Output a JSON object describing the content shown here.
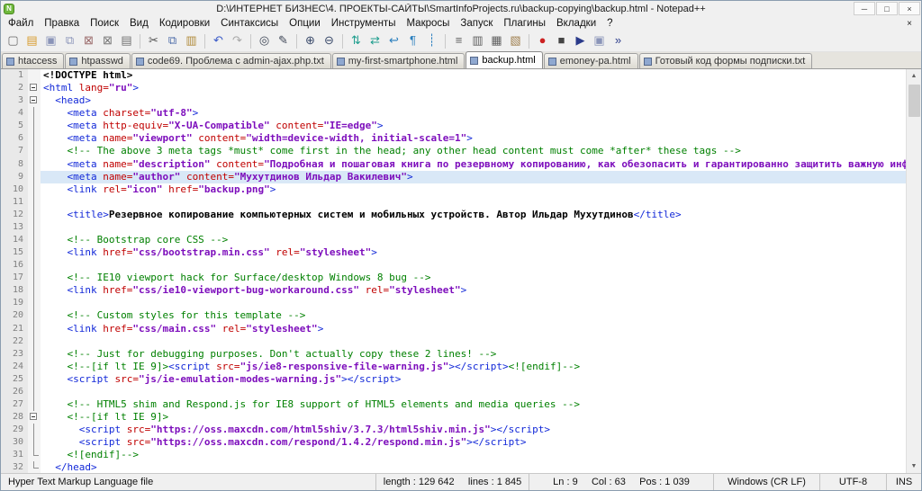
{
  "titlebar": {
    "title": "D:\\ИНТЕРНЕТ БИЗНЕС\\4. ПРОЕКТЫ-САЙТЫ\\SmartInfoProjects.ru\\backup-copying\\backup.html - Notepad++",
    "logo_letter": "N",
    "buttons": [
      {
        "name": "minimize",
        "glyph": "─"
      },
      {
        "name": "maximize",
        "glyph": "□"
      },
      {
        "name": "close",
        "glyph": "×"
      }
    ]
  },
  "menubar": {
    "items": [
      "Файл",
      "Правка",
      "Поиск",
      "Вид",
      "Кодировки",
      "Синтаксисы",
      "Опции",
      "Инструменты",
      "Макросы",
      "Запуск",
      "Плагины",
      "Вкладки",
      "?"
    ],
    "close_glyph": "×"
  },
  "toolbar": {
    "icons": [
      {
        "name": "new-file",
        "glyph": "▢",
        "color": "#6a6a6a"
      },
      {
        "name": "open-folder",
        "glyph": "▤",
        "color": "#d89c2e"
      },
      {
        "name": "save-file",
        "glyph": "▣",
        "color": "#8a94b8"
      },
      {
        "name": "save-all",
        "glyph": "⧉",
        "color": "#8a94b8"
      },
      {
        "name": "close-file",
        "glyph": "⊠",
        "color": "#9a6a6a"
      },
      {
        "name": "close-all",
        "glyph": "⊠",
        "color": "#777777"
      },
      {
        "name": "print",
        "glyph": "▤",
        "color": "#707070"
      },
      {
        "sep": true
      },
      {
        "name": "cut",
        "glyph": "✂",
        "color": "#505050"
      },
      {
        "name": "copy",
        "glyph": "⧉",
        "color": "#4a6aa8"
      },
      {
        "name": "paste",
        "glyph": "▥",
        "color": "#b08a3a"
      },
      {
        "sep": true
      },
      {
        "name": "undo",
        "glyph": "↶",
        "color": "#3a5ac8"
      },
      {
        "name": "redo",
        "glyph": "↷",
        "color": "#a8a8a8"
      },
      {
        "sep": true
      },
      {
        "name": "find",
        "glyph": "◎",
        "color": "#404858"
      },
      {
        "name": "replace",
        "glyph": "✎",
        "color": "#404858"
      },
      {
        "sep": true
      },
      {
        "name": "zoom-in",
        "glyph": "⊕",
        "color": "#3a4a6a"
      },
      {
        "name": "zoom-out",
        "glyph": "⊖",
        "color": "#3a4a6a"
      },
      {
        "sep": true
      },
      {
        "name": "sync-vertical-scroll",
        "glyph": "⇅",
        "color": "#1f9e8e"
      },
      {
        "name": "sync-horizontal-scroll",
        "glyph": "⇄",
        "color": "#1f9e8e"
      },
      {
        "name": "word-wrap",
        "glyph": "↩",
        "color": "#2a7fbe"
      },
      {
        "name": "show-all-characters",
        "glyph": "¶",
        "color": "#2a7fbe"
      },
      {
        "name": "indent-guide",
        "glyph": "┊",
        "color": "#2a7fbe"
      },
      {
        "sep": true
      },
      {
        "name": "function-list",
        "glyph": "≡",
        "color": "#606060"
      },
      {
        "name": "document-map",
        "glyph": "▥",
        "color": "#606060"
      },
      {
        "name": "document-list",
        "glyph": "▦",
        "color": "#606060"
      },
      {
        "name": "folder-as-workspace",
        "glyph": "▧",
        "color": "#a08050"
      },
      {
        "sep": true
      },
      {
        "name": "macro-record",
        "glyph": "●",
        "color": "#cc2222"
      },
      {
        "name": "macro-stop",
        "glyph": "■",
        "color": "#444444"
      },
      {
        "name": "macro-play",
        "glyph": "▶",
        "color": "#2a3a8a"
      },
      {
        "name": "macro-save",
        "glyph": "▣",
        "color": "#8a94b8"
      },
      {
        "name": "macro-run-multiple",
        "glyph": "»",
        "color": "#2a3a8a"
      }
    ]
  },
  "tabbar": {
    "tabs": [
      {
        "label": "htaccess",
        "active": false
      },
      {
        "label": "htpasswd",
        "active": false
      },
      {
        "label": "code69. Проблема с admin-ajax.php.txt",
        "active": false
      },
      {
        "label": "my-first-smartphone.html",
        "active": false
      },
      {
        "label": "backup.html",
        "active": true
      },
      {
        "label": "emoney-pa.html",
        "active": false
      },
      {
        "label": "Готовый код формы подписки.txt",
        "active": false
      }
    ]
  },
  "editor": {
    "current_line": 9,
    "lines": [
      {
        "n": 1,
        "fold": "",
        "tokens": [
          [
            "d",
            "<!DOCTYPE html>"
          ]
        ]
      },
      {
        "n": 2,
        "fold": "o",
        "tokens": [
          [
            "t",
            "<html "
          ],
          [
            "a",
            "lang="
          ],
          [
            "v",
            "\"ru\""
          ],
          [
            "t",
            ">"
          ]
        ]
      },
      {
        "n": 3,
        "fold": "o",
        "tokens": [
          [
            "t",
            "  <head>"
          ]
        ]
      },
      {
        "n": 4,
        "fold": "p",
        "tokens": [
          [
            "t",
            "    <meta "
          ],
          [
            "a",
            "charset="
          ],
          [
            "v",
            "\"utf-8\""
          ],
          [
            "t",
            ">"
          ]
        ]
      },
      {
        "n": 5,
        "fold": "p",
        "tokens": [
          [
            "t",
            "    <meta "
          ],
          [
            "a",
            "http-equiv="
          ],
          [
            "v",
            "\"X-UA-Compatible\""
          ],
          [
            "a",
            " content="
          ],
          [
            "v",
            "\"IE=edge\""
          ],
          [
            "t",
            ">"
          ]
        ]
      },
      {
        "n": 6,
        "fold": "p",
        "tokens": [
          [
            "t",
            "    <meta "
          ],
          [
            "a",
            "name="
          ],
          [
            "v",
            "\"viewport\""
          ],
          [
            "a",
            " content="
          ],
          [
            "v",
            "\"width=device-width, initial-scale=1\""
          ],
          [
            "t",
            ">"
          ]
        ]
      },
      {
        "n": 7,
        "fold": "p",
        "tokens": [
          [
            "c",
            "    <!-- The above 3 meta tags *must* come first in the head; any other head content must come *after* these tags -->"
          ]
        ]
      },
      {
        "n": 8,
        "fold": "p",
        "tokens": [
          [
            "t",
            "    <meta "
          ],
          [
            "a",
            "name="
          ],
          [
            "v",
            "\"description\""
          ],
          [
            "a",
            " content="
          ],
          [
            "v",
            "\"Подробная и пошаговая книга по резервному копированию, как обезопасить и гарантированно защитить важную информацию от внез"
          ]
        ]
      },
      {
        "n": 9,
        "fold": "p",
        "tokens": [
          [
            "t",
            "    <meta "
          ],
          [
            "a",
            "name="
          ],
          [
            "v",
            "\"author\""
          ],
          [
            "a",
            " content="
          ],
          [
            "v",
            "\"Мухутдинов Ильдар Вакилевич\""
          ],
          [
            "t",
            ">"
          ]
        ]
      },
      {
        "n": 10,
        "fold": "p",
        "tokens": [
          [
            "t",
            "    <link "
          ],
          [
            "a",
            "rel="
          ],
          [
            "v",
            "\"icon\""
          ],
          [
            "a",
            " href="
          ],
          [
            "v",
            "\"backup.png\""
          ],
          [
            "t",
            ">"
          ]
        ]
      },
      {
        "n": 11,
        "fold": "p",
        "tokens": []
      },
      {
        "n": 12,
        "fold": "p",
        "tokens": [
          [
            "t",
            "    <title>"
          ],
          [
            "b",
            "Резервное копирование компьютерных систем и мобильных устройств. Автор Ильдар Мухутдинов"
          ],
          [
            "t",
            "</title>"
          ]
        ]
      },
      {
        "n": 13,
        "fold": "p",
        "tokens": []
      },
      {
        "n": 14,
        "fold": "p",
        "tokens": [
          [
            "c",
            "    <!-- Bootstrap core CSS -->"
          ]
        ]
      },
      {
        "n": 15,
        "fold": "p",
        "tokens": [
          [
            "t",
            "    <link "
          ],
          [
            "a",
            "href="
          ],
          [
            "v",
            "\"css/bootstrap.min.css\""
          ],
          [
            "a",
            " rel="
          ],
          [
            "v",
            "\"stylesheet\""
          ],
          [
            "t",
            ">"
          ]
        ]
      },
      {
        "n": 16,
        "fold": "p",
        "tokens": []
      },
      {
        "n": 17,
        "fold": "p",
        "tokens": [
          [
            "c",
            "    <!-- IE10 viewport hack for Surface/desktop Windows 8 bug -->"
          ]
        ]
      },
      {
        "n": 18,
        "fold": "p",
        "tokens": [
          [
            "t",
            "    <link "
          ],
          [
            "a",
            "href="
          ],
          [
            "v",
            "\"css/ie10-viewport-bug-workaround.css\""
          ],
          [
            "a",
            " rel="
          ],
          [
            "v",
            "\"stylesheet\""
          ],
          [
            "t",
            ">"
          ]
        ]
      },
      {
        "n": 19,
        "fold": "p",
        "tokens": []
      },
      {
        "n": 20,
        "fold": "p",
        "tokens": [
          [
            "c",
            "    <!-- Custom styles for this template -->"
          ]
        ]
      },
      {
        "n": 21,
        "fold": "p",
        "tokens": [
          [
            "t",
            "    <link "
          ],
          [
            "a",
            "href="
          ],
          [
            "v",
            "\"css/main.css\""
          ],
          [
            "a",
            " rel="
          ],
          [
            "v",
            "\"stylesheet\""
          ],
          [
            "t",
            ">"
          ]
        ]
      },
      {
        "n": 22,
        "fold": "p",
        "tokens": []
      },
      {
        "n": 23,
        "fold": "p",
        "tokens": [
          [
            "c",
            "    <!-- Just for debugging purposes. Don't actually copy these 2 lines! -->"
          ]
        ]
      },
      {
        "n": 24,
        "fold": "p",
        "tokens": [
          [
            "c",
            "    <!--[if lt IE 9]>"
          ],
          [
            "t",
            "<script "
          ],
          [
            "a",
            "src="
          ],
          [
            "v",
            "\"js/ie8-responsive-file-warning.js\""
          ],
          [
            "t",
            "></script>"
          ],
          [
            "c",
            "<![endif]-->"
          ]
        ]
      },
      {
        "n": 25,
        "fold": "p",
        "tokens": [
          [
            "t",
            "    <script "
          ],
          [
            "a",
            "src="
          ],
          [
            "v",
            "\"js/ie-emulation-modes-warning.js\""
          ],
          [
            "t",
            "></script>"
          ]
        ]
      },
      {
        "n": 26,
        "fold": "p",
        "tokens": []
      },
      {
        "n": 27,
        "fold": "p",
        "tokens": [
          [
            "c",
            "    <!-- HTML5 shim and Respond.js for IE8 support of HTML5 elements and media queries -->"
          ]
        ]
      },
      {
        "n": 28,
        "fold": "o",
        "tokens": [
          [
            "c",
            "    <!--[if lt IE 9]>"
          ]
        ]
      },
      {
        "n": 29,
        "fold": "p",
        "tokens": [
          [
            "t",
            "      <script "
          ],
          [
            "a",
            "src="
          ],
          [
            "v",
            "\"https://oss.maxcdn.com/html5shiv/3.7.3/html5shiv.min.js\""
          ],
          [
            "t",
            "></script>"
          ]
        ]
      },
      {
        "n": 30,
        "fold": "p",
        "tokens": [
          [
            "t",
            "      <script "
          ],
          [
            "a",
            "src="
          ],
          [
            "v",
            "\"https://oss.maxcdn.com/respond/1.4.2/respond.min.js\""
          ],
          [
            "t",
            "></script>"
          ]
        ]
      },
      {
        "n": 31,
        "fold": "L",
        "tokens": [
          [
            "c",
            "    <![endif]-->"
          ]
        ]
      },
      {
        "n": 32,
        "fold": "L",
        "tokens": [
          [
            "t",
            "  </head>"
          ]
        ]
      }
    ]
  },
  "statusbar": {
    "doc_type": "Hyper Text Markup Language file",
    "length_lines": "length : 129 642     lines : 1 845",
    "cursor": "Ln : 9     Col : 63     Pos : 1 039",
    "eol": "Windows (CR LF)",
    "encoding": "UTF-8",
    "mode": "INS"
  }
}
